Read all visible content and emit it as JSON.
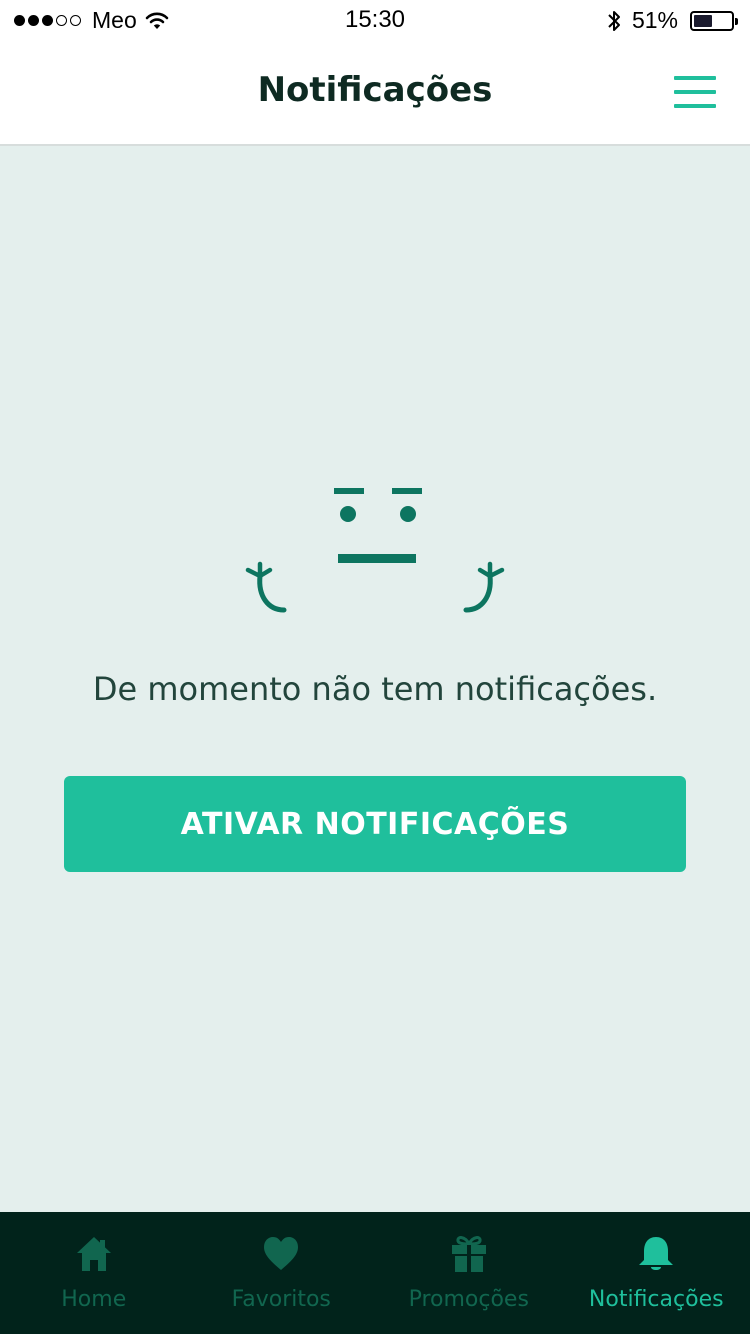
{
  "status_bar": {
    "carrier": "Meo",
    "time": "15:30",
    "battery": "51%",
    "battery_level": 0.51,
    "signal_bars_filled": 3,
    "signal_bars_total": 5
  },
  "header": {
    "title": "Notificações",
    "menu_icon": "hamburger-menu-icon"
  },
  "empty_state": {
    "illustration_icon": "shrug-face-icon",
    "message": "De momento não tem notificações.",
    "button_label": "ATIVAR NOTIFICAÇÕES"
  },
  "tabs": [
    {
      "label": "Home",
      "icon": "home-icon",
      "active": false
    },
    {
      "label": "Favoritos",
      "icon": "heart-icon",
      "active": false
    },
    {
      "label": "Promoções",
      "icon": "gift-icon",
      "active": false
    },
    {
      "label": "Notificações",
      "icon": "bell-icon",
      "active": true
    }
  ],
  "colors": {
    "accent": "#1fbf9c",
    "tab_bar_bg": "#01231b",
    "tab_inactive": "#11664f",
    "content_bg": "#e4efed",
    "illustration": "#0d7560",
    "title_text": "#0e2a22"
  }
}
